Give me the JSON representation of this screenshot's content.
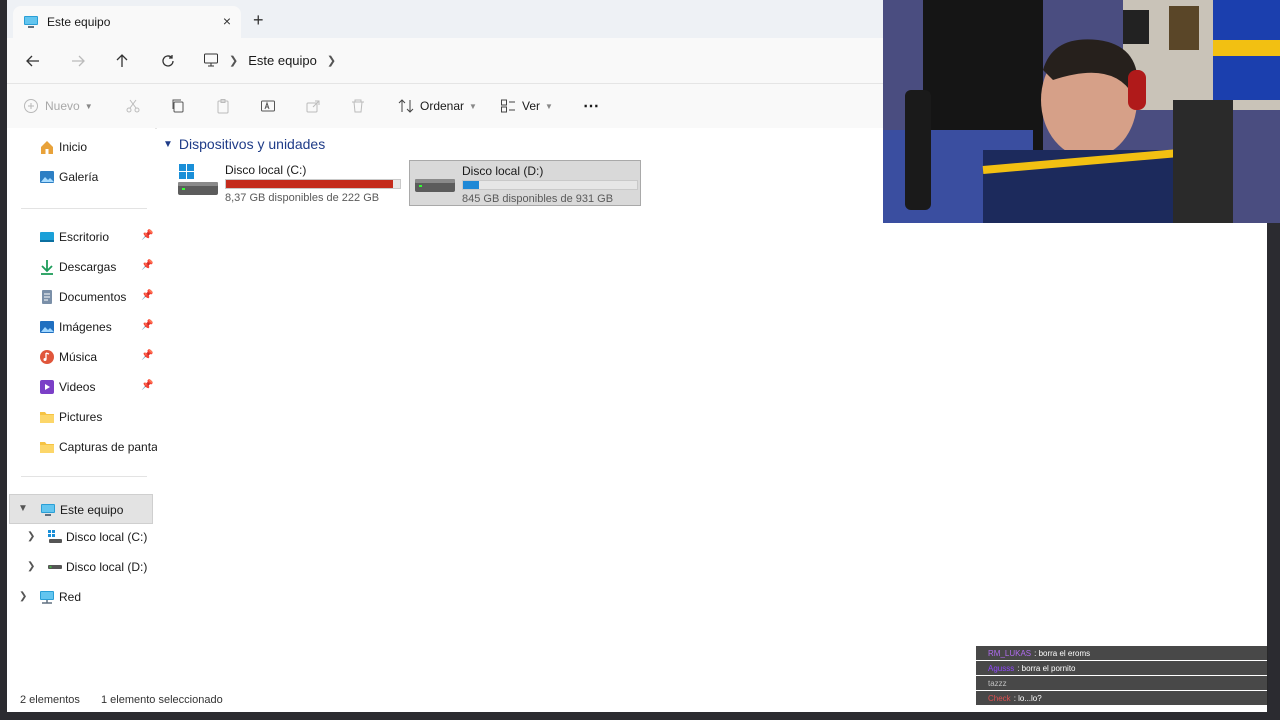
{
  "window": {
    "tab_title": "Este equipo",
    "tab_close": "×",
    "new_tab": "+"
  },
  "address": {
    "breadcrumb": [
      "Este equipo"
    ]
  },
  "toolbar": {
    "new_label": "Nuevo",
    "sort_label": "Ordenar",
    "view_label": "Ver",
    "more_label": "⋯"
  },
  "sidebar": {
    "top": [
      {
        "label": "Inicio",
        "icon": "home-icon"
      },
      {
        "label": "Galería",
        "icon": "gallery-icon"
      }
    ],
    "quick_access": [
      {
        "label": "Escritorio",
        "icon": "desktop-folder-icon",
        "pinned": true
      },
      {
        "label": "Descargas",
        "icon": "download-folder-icon",
        "pinned": true
      },
      {
        "label": "Documentos",
        "icon": "documents-folder-icon",
        "pinned": true
      },
      {
        "label": "Imágenes",
        "icon": "pictures-folder-icon",
        "pinned": true
      },
      {
        "label": "Música",
        "icon": "music-folder-icon",
        "pinned": true
      },
      {
        "label": "Videos",
        "icon": "videos-folder-icon",
        "pinned": true
      },
      {
        "label": "Pictures",
        "icon": "folder-icon",
        "pinned": false
      },
      {
        "label": "Capturas de pantall",
        "icon": "folder-icon",
        "pinned": false
      }
    ],
    "this_pc": {
      "label": "Este equipo",
      "icon": "computer-icon"
    },
    "drives": [
      {
        "label": "Disco local (C:)",
        "icon": "windows-drive-icon"
      },
      {
        "label": "Disco local (D:)",
        "icon": "drive-icon"
      }
    ],
    "network": {
      "label": "Red",
      "icon": "network-icon"
    }
  },
  "main": {
    "group_title": "Dispositivos y unidades",
    "drives": [
      {
        "name": "Disco local (C:)",
        "free_text": "8,37 GB disponibles de 222 GB",
        "used_fraction": 0.962,
        "bar_color": "#c42b1c"
      },
      {
        "name": "Disco local (D:)",
        "free_text": "845 GB disponibles de 931 GB",
        "used_fraction": 0.092,
        "bar_color": "#1e88d6"
      }
    ]
  },
  "status": {
    "item_count": "2 elementos",
    "selection": "1 elemento seleccionado"
  },
  "chat": {
    "messages": [
      {
        "user": "RM_LUKAS",
        "user_color": "#b06bf0",
        "text": ": borra el eroms"
      },
      {
        "user": "Agusss",
        "user_color": "#9147ff",
        "text": ": borra el pornito"
      },
      {
        "user": "tazzz",
        "user_color": "#c0c0c0",
        "text": ""
      },
      {
        "user": "Check",
        "user_color": "#e05050",
        "text": ": lo...lo?"
      }
    ]
  },
  "colors": {
    "accent": "#0067c0",
    "group_title": "#1f3c88",
    "c_drive_bar": "#c42b1c",
    "d_drive_bar": "#1e88d6"
  }
}
